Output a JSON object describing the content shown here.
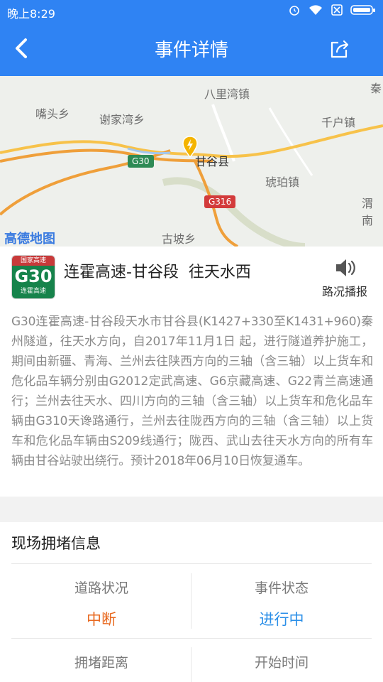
{
  "status_bar": {
    "time": "晚上8:29"
  },
  "nav": {
    "title": "事件详情"
  },
  "map": {
    "labels": [
      "八里湾镇",
      "嘴头乡",
      "谢家湾乡",
      "千户镇",
      "甘谷县",
      "琥珀镇",
      "古坡乡",
      "渭南",
      "秦"
    ],
    "shields": [
      "G30",
      "G316"
    ],
    "brand": "高德地图"
  },
  "event": {
    "badge": {
      "top": "国家高速",
      "code": "G30",
      "sub": "连霍高速"
    },
    "title": "连霍高速-甘谷段  往天水西",
    "broadcast_label": "路况播报",
    "description": "G30连霍高速-甘谷段天水市甘谷县(K1427+330至K1431+960)秦州隧道，往天水方向，自2017年11月1日 起，进行隧道养护施工，期间由新疆、青海、兰州去往陕西方向的三轴（含三轴）以上货车和危化品车辆分别由G2012定武高速、G6京藏高速、G22青兰高速通行；兰州去往天水、四川方向的三轴（含三轴）以上货车和危化品车辆由G310天谗路通行，兰州去往陇西方向的三轴（含三轴）以上货车和危化品车辆由S209线通行；陇西、武山去往天水方向的所有车辆由甘谷站驶出绕行。预计2018年06月10日恢复通车。"
  },
  "info": {
    "title": "现场拥堵信息",
    "road_status_label": "道路状况",
    "road_status_value": "中断",
    "event_status_label": "事件状态",
    "event_status_value": "进行中",
    "distance_label": "拥堵距离",
    "start_time_label": "开始时间"
  },
  "colors": {
    "header": "#2f83f3",
    "interrupted": "#e8691f",
    "in_progress": "#2b8fe8"
  }
}
